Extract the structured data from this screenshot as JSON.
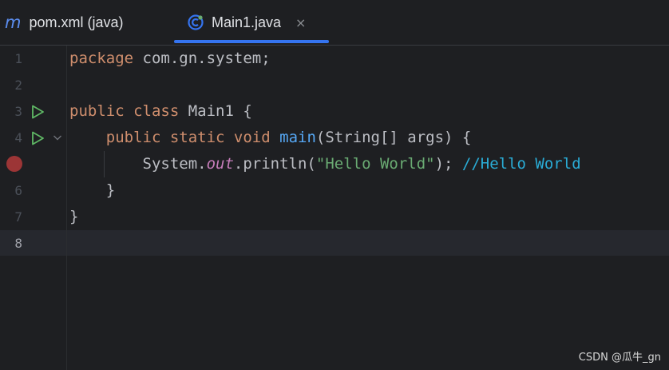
{
  "tabs": [
    {
      "label": "pom.xml (java)",
      "icon": "maven-m-icon",
      "active": false
    },
    {
      "label": "Main1.java",
      "icon": "java-class-icon",
      "active": true,
      "close": "×"
    }
  ],
  "editor": {
    "lines": [
      {
        "n": "1",
        "segments": [
          {
            "t": "package",
            "c": "kw"
          },
          {
            "t": " com.gn.system;",
            "c": ""
          }
        ]
      },
      {
        "n": "2",
        "segments": []
      },
      {
        "n": "3",
        "gutter_icon": "run-icon",
        "segments": [
          {
            "t": "public class",
            "c": "kw"
          },
          {
            "t": " Main1 {",
            "c": ""
          }
        ]
      },
      {
        "n": "4",
        "gutter_icon": "run-icon",
        "segments": [
          {
            "t": "    ",
            "c": ""
          },
          {
            "t": "public static void",
            "c": "kw"
          },
          {
            "t": " ",
            "c": ""
          },
          {
            "t": "main",
            "c": "fn"
          },
          {
            "t": "(String[] args) {",
            "c": ""
          }
        ]
      },
      {
        "n": "5",
        "gutter_icon": "breakpoint-icon",
        "segments": [
          {
            "t": "        System.",
            "c": ""
          },
          {
            "t": "out",
            "c": "field"
          },
          {
            "t": ".println(",
            "c": ""
          },
          {
            "t": "\"Hello World\"",
            "c": "str"
          },
          {
            "t": "); ",
            "c": ""
          },
          {
            "t": "//Hello World",
            "c": "cm"
          }
        ]
      },
      {
        "n": "6",
        "segments": [
          {
            "t": "    }",
            "c": ""
          }
        ]
      },
      {
        "n": "7",
        "segments": [
          {
            "t": "}",
            "c": ""
          }
        ]
      },
      {
        "n": "8",
        "segments": [],
        "current": true
      }
    ]
  },
  "watermark": "CSDN @瓜牛_gn",
  "colors": {
    "background": "#1e1f22",
    "keyword": "#cf8e6d",
    "function": "#56a8f5",
    "string": "#6aab73",
    "comment": "#2aacd6",
    "field": "#c77dbb",
    "tab_underline": "#3574f0",
    "breakpoint": "#b33a3a"
  }
}
